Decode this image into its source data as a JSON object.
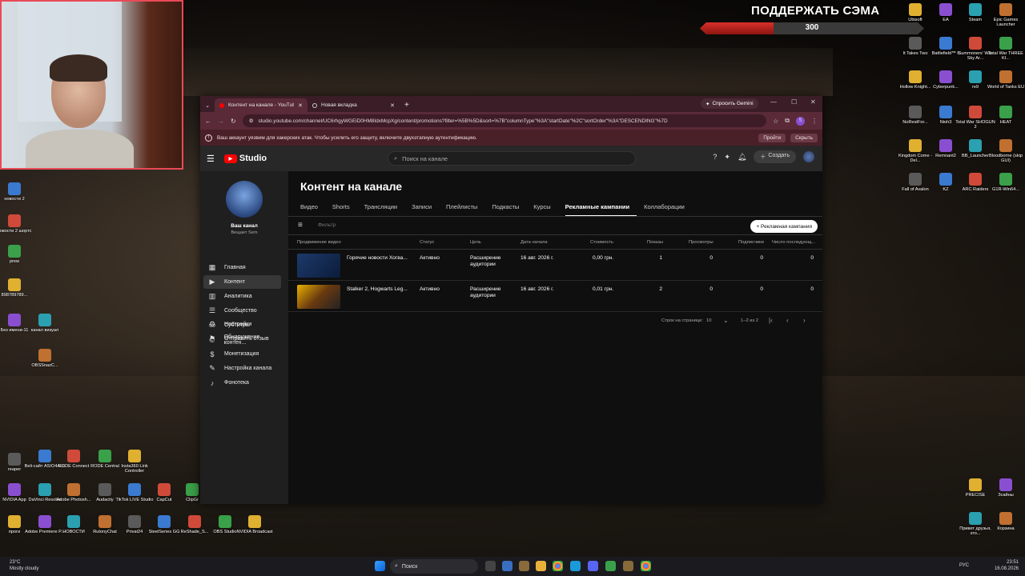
{
  "overlay": {
    "donation_title": "ПОДДЕРЖАТЬ СЭМА",
    "donation_value": "300",
    "donation_progress": 0.33
  },
  "desktop_left": {
    "icons": [
      {
        "label": "новости 2"
      },
      {
        "label": "новости 2 шортс"
      },
      {
        "label": "prew"
      },
      {
        "label": "898789789..."
      },
      {
        "label": "Без имени-11"
      },
      {
        "label": "канал визуал"
      },
      {
        "label": "OBSSnazC..."
      },
      {
        "label": "reaper"
      },
      {
        "label": "Beli-сайт ASIO4ALL"
      },
      {
        "label": "RODE Connect"
      },
      {
        "label": "RODE Central"
      },
      {
        "label": "Insta360 Link Controller"
      },
      {
        "label": "NVIDIA App"
      },
      {
        "label": "DaVinci Resolve"
      },
      {
        "label": "Adobe Photosh..."
      },
      {
        "label": "Audacity"
      },
      {
        "label": "TikTok LIVE Studio"
      },
      {
        "label": "CapCut"
      },
      {
        "label": "ClipGr"
      },
      {
        "label": "проги"
      },
      {
        "label": "Adobe Premiere P..."
      },
      {
        "label": "НОВОСТИ"
      },
      {
        "label": "RutonyChat"
      },
      {
        "label": "Privat24"
      },
      {
        "label": "SteelSeries GG"
      },
      {
        "label": "ReShade_S..."
      },
      {
        "label": "OBS Studio"
      },
      {
        "label": "NVIDIA Broadcast"
      }
    ]
  },
  "desktop_right": {
    "icons": [
      {
        "label": "Ubisoft"
      },
      {
        "label": "EA"
      },
      {
        "label": "Steam"
      },
      {
        "label": "Epic Games Launcher"
      },
      {
        "label": "It Takes Two"
      },
      {
        "label": "Battlefield™ 6"
      },
      {
        "label": "Summoners' War Sky Ar..."
      },
      {
        "label": "Total War THREE KI..."
      },
      {
        "label": "Hollow Knight..."
      },
      {
        "label": "Cyberpunk..."
      },
      {
        "label": "re9"
      },
      {
        "label": "World of Tanks EU"
      },
      {
        "label": "NoRestFor..."
      },
      {
        "label": "Nioh3"
      },
      {
        "label": "Total War SHOGUN 2"
      },
      {
        "label": "HEAT"
      },
      {
        "label": "Kingdom Come - Del..."
      },
      {
        "label": "Remnant2"
      },
      {
        "label": "BB_Launcher"
      },
      {
        "label": "Bloodborne (skip GUI)"
      },
      {
        "label": "Fall of Avalon"
      },
      {
        "label": "KZ"
      },
      {
        "label": "ARC Raiders"
      },
      {
        "label": "G1R-Win64..."
      },
      {
        "label": "PRECISE"
      },
      {
        "label": "Зсайны"
      },
      {
        "label": "Привет друзья, это..."
      },
      {
        "label": "Корзина"
      }
    ]
  },
  "browser": {
    "tabs": [
      {
        "label": "Контент на канале - YouTube S"
      },
      {
        "label": "Новая вкладка"
      }
    ],
    "gemini_label": "Спросить Gemini",
    "url": "studio.youtube.com/channel/UC6rhgyWGEiD0HM8IdxMcpXg/content/promotions?filter=%5B%5D&sort=%7B\"columnType\"%3A\"startDate\"%2C\"sortOrder\"%3A\"DESCENDING\"%7D",
    "profile_initial": "S",
    "warning_text": "Ваш аккаунт уязвим для хакерских атак. Чтобы усилить его защиту, включите двухэтапную аутентификацию.",
    "warning_go": "Пройти",
    "warning_hide": "Скрыть"
  },
  "studio": {
    "logo_text": "Studio",
    "search_placeholder": "Поиск на канале",
    "create_label": "Создать",
    "channel_name": "Ваш канал",
    "channel_sub": "Вещает Sem",
    "nav": [
      {
        "label": "Главная",
        "icon": "dashboard-icon"
      },
      {
        "label": "Контент",
        "icon": "content-icon"
      },
      {
        "label": "Аналитика",
        "icon": "analytics-icon"
      },
      {
        "label": "Сообщество",
        "icon": "community-icon"
      },
      {
        "label": "Субтитры",
        "icon": "subtitles-icon"
      },
      {
        "label": "Обнаружение контен...",
        "icon": "copyright-icon"
      },
      {
        "label": "Монетизация",
        "icon": "monetization-icon"
      },
      {
        "label": "Настройка канала",
        "icon": "customization-icon"
      },
      {
        "label": "Фонотека",
        "icon": "audio-library-icon"
      }
    ],
    "nav_bottom": [
      {
        "label": "Настройки"
      },
      {
        "label": "Отправить отзыв"
      }
    ],
    "page_title": "Контент на канале",
    "content_tabs": [
      {
        "label": "Видео"
      },
      {
        "label": "Shorts"
      },
      {
        "label": "Трансляции"
      },
      {
        "label": "Записи"
      },
      {
        "label": "Плейлисты"
      },
      {
        "label": "Подкасты"
      },
      {
        "label": "Курсы"
      },
      {
        "label": "Рекламные кампании"
      },
      {
        "label": "Коллаборации"
      }
    ],
    "filter_placeholder": "Фильтр",
    "new_campaign_label": "+ Рекламная кампания",
    "columns": [
      "Продвижение видео",
      "Статус",
      "Цель",
      "Дата начала",
      "Стоимость",
      "Показы",
      "Просмотры",
      "Подписчики",
      "Число последующ..."
    ],
    "rows": [
      {
        "title": "Горячие новости Хогва...",
        "status": "Активно",
        "goal": "Расширение аудитории",
        "date": "16 авг. 2026 г.",
        "cost": "0,00 грн.",
        "impressions": "1",
        "views": "0",
        "subs": "0",
        "subsequent": "0"
      },
      {
        "title": "Stalker 2, Hogwarts Leg...",
        "status": "Активно",
        "goal": "Расширение аудитории",
        "date": "16 авг. 2026 г.",
        "cost": "0,01 грн.",
        "impressions": "2",
        "views": "0",
        "subs": "0",
        "subsequent": "0"
      }
    ],
    "rows_per_page_label": "Строк на странице:",
    "rows_per_page_value": "10",
    "range_label": "1–2 из 2"
  },
  "taskbar": {
    "weather_temp": "23°C",
    "weather_desc": "Mostly cloudy",
    "search_label": "Поиск",
    "lang": "РУС",
    "time": "23:51",
    "date": "16.08.2026"
  }
}
